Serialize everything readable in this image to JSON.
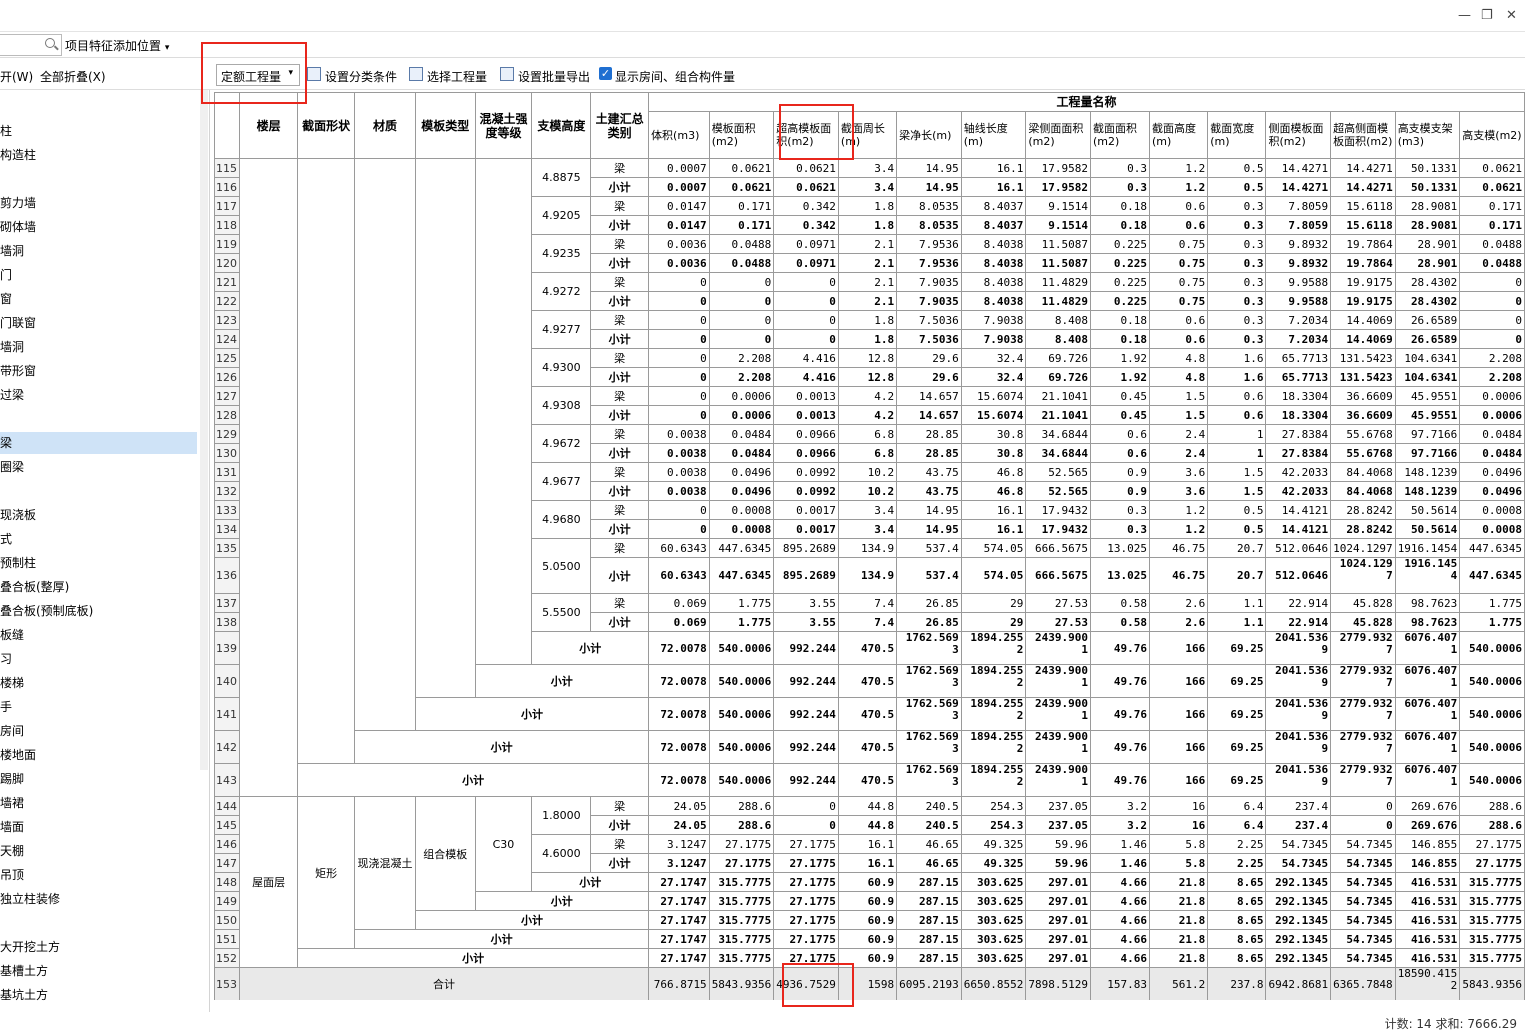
{
  "toolbar": {
    "feature_pos": "项目特征添加位置",
    "expand": "开(W)",
    "collapse_all": "全部折叠(X)",
    "quota_combo": "定额工程量",
    "set_category": "设置分类条件",
    "select_qty": "选择工程量",
    "batch_export": "设置批量导出",
    "show_rooms": "显示房间、组合构件量"
  },
  "sidebar": [
    "柱",
    "构造柱",
    "",
    "剪力墙",
    "砌体墙",
    "墙洞",
    "门",
    "窗",
    "门联窗",
    "墙洞",
    "带形窗",
    "过梁",
    "",
    "梁",
    "圈梁",
    "",
    "现浇板",
    "式",
    "预制柱",
    "叠合板(整厚)",
    "叠合板(预制底板)",
    "板缝",
    "习",
    "楼梯",
    "手",
    "房间",
    "楼地面",
    "踢脚",
    "墙裙",
    "墙面",
    "天棚",
    "吊顶",
    "独立柱装修",
    "",
    "大开挖土方",
    "基槽土方",
    "基坑土方"
  ],
  "header": {
    "floor": "楼层",
    "section": "截面形状",
    "material": "材质",
    "formwork": "模板类型",
    "concrete": "混凝土强度等级",
    "height": "支模高度",
    "category": "土建汇总类别",
    "qty_group": "工程量名称",
    "cols": [
      "体积(m3)",
      "模板面积(m2)",
      "超高模板面积(m2)",
      "截面周长(m)",
      "梁净长(m)",
      "轴线长度(m)",
      "梁侧面面积(m2)",
      "截面面积(m2)",
      "截面高度(m)",
      "截面宽度(m)",
      "侧面模板面积(m2)",
      "超高侧面模板面积(m2)",
      "高支模支架(m3)",
      "高支模(m2)"
    ]
  },
  "labels": {
    "beam": "梁",
    "subtotal": "小计",
    "total": "合计"
  },
  "heights": [
    {
      "h": "4.8875",
      "beam": [
        "0.0007",
        "0.0621",
        "0.0621",
        "3.4",
        "14.95",
        "16.1",
        "17.9582",
        "0.3",
        "1.2",
        "0.5",
        "14.4271",
        "14.4271",
        "50.1331",
        "0.0621"
      ],
      "sub": [
        "0.0007",
        "0.0621",
        "0.0621",
        "3.4",
        "14.95",
        "16.1",
        "17.9582",
        "0.3",
        "1.2",
        "0.5",
        "14.4271",
        "14.4271",
        "50.1331",
        "0.0621"
      ]
    },
    {
      "h": "4.9205",
      "beam": [
        "0.0147",
        "0.171",
        "0.342",
        "1.8",
        "8.0535",
        "8.4037",
        "9.1514",
        "0.18",
        "0.6",
        "0.3",
        "7.8059",
        "15.6118",
        "28.9081",
        "0.171"
      ],
      "sub": [
        "0.0147",
        "0.171",
        "0.342",
        "1.8",
        "8.0535",
        "8.4037",
        "9.1514",
        "0.18",
        "0.6",
        "0.3",
        "7.8059",
        "15.6118",
        "28.9081",
        "0.171"
      ]
    },
    {
      "h": "4.9235",
      "beam": [
        "0.0036",
        "0.0488",
        "0.0971",
        "2.1",
        "7.9536",
        "8.4038",
        "11.5087",
        "0.225",
        "0.75",
        "0.3",
        "9.8932",
        "19.7864",
        "28.901",
        "0.0488"
      ],
      "sub": [
        "0.0036",
        "0.0488",
        "0.0971",
        "2.1",
        "7.9536",
        "8.4038",
        "11.5087",
        "0.225",
        "0.75",
        "0.3",
        "9.8932",
        "19.7864",
        "28.901",
        "0.0488"
      ]
    },
    {
      "h": "4.9272",
      "beam": [
        "0",
        "0",
        "0",
        "2.1",
        "7.9035",
        "8.4038",
        "11.4829",
        "0.225",
        "0.75",
        "0.3",
        "9.9588",
        "19.9175",
        "28.4302",
        "0"
      ],
      "sub": [
        "0",
        "0",
        "0",
        "2.1",
        "7.9035",
        "8.4038",
        "11.4829",
        "0.225",
        "0.75",
        "0.3",
        "9.9588",
        "19.9175",
        "28.4302",
        "0"
      ]
    },
    {
      "h": "4.9277",
      "beam": [
        "0",
        "0",
        "0",
        "1.8",
        "7.5036",
        "7.9038",
        "8.408",
        "0.18",
        "0.6",
        "0.3",
        "7.2034",
        "14.4069",
        "26.6589",
        "0"
      ],
      "sub": [
        "0",
        "0",
        "0",
        "1.8",
        "7.5036",
        "7.9038",
        "8.408",
        "0.18",
        "0.6",
        "0.3",
        "7.2034",
        "14.4069",
        "26.6589",
        "0"
      ]
    },
    {
      "h": "4.9300",
      "beam": [
        "0",
        "2.208",
        "4.416",
        "12.8",
        "29.6",
        "32.4",
        "69.726",
        "1.92",
        "4.8",
        "1.6",
        "65.7713",
        "131.5423",
        "104.6341",
        "2.208"
      ],
      "sub": [
        "0",
        "2.208",
        "4.416",
        "12.8",
        "29.6",
        "32.4",
        "69.726",
        "1.92",
        "4.8",
        "1.6",
        "65.7713",
        "131.5423",
        "104.6341",
        "2.208"
      ]
    },
    {
      "h": "4.9308",
      "beam": [
        "0",
        "0.0006",
        "0.0013",
        "4.2",
        "14.657",
        "15.6074",
        "21.1041",
        "0.45",
        "1.5",
        "0.6",
        "18.3304",
        "36.6609",
        "45.9551",
        "0.0006"
      ],
      "sub": [
        "0",
        "0.0006",
        "0.0013",
        "4.2",
        "14.657",
        "15.6074",
        "21.1041",
        "0.45",
        "1.5",
        "0.6",
        "18.3304",
        "36.6609",
        "45.9551",
        "0.0006"
      ]
    },
    {
      "h": "4.9672",
      "beam": [
        "0.0038",
        "0.0484",
        "0.0966",
        "6.8",
        "28.85",
        "30.8",
        "34.6844",
        "0.6",
        "2.4",
        "1",
        "27.8384",
        "55.6768",
        "97.7166",
        "0.0484"
      ],
      "sub": [
        "0.0038",
        "0.0484",
        "0.0966",
        "6.8",
        "28.85",
        "30.8",
        "34.6844",
        "0.6",
        "2.4",
        "1",
        "27.8384",
        "55.6768",
        "97.7166",
        "0.0484"
      ]
    },
    {
      "h": "4.9677",
      "beam": [
        "0.0038",
        "0.0496",
        "0.0992",
        "10.2",
        "43.75",
        "46.8",
        "52.565",
        "0.9",
        "3.6",
        "1.5",
        "42.2033",
        "84.4068",
        "148.1239",
        "0.0496"
      ],
      "sub": [
        "0.0038",
        "0.0496",
        "0.0992",
        "10.2",
        "43.75",
        "46.8",
        "52.565",
        "0.9",
        "3.6",
        "1.5",
        "42.2033",
        "84.4068",
        "148.1239",
        "0.0496"
      ]
    },
    {
      "h": "4.9680",
      "beam": [
        "0",
        "0.0008",
        "0.0017",
        "3.4",
        "14.95",
        "16.1",
        "17.9432",
        "0.3",
        "1.2",
        "0.5",
        "14.4121",
        "28.8242",
        "50.5614",
        "0.0008"
      ],
      "sub": [
        "0",
        "0.0008",
        "0.0017",
        "3.4",
        "14.95",
        "16.1",
        "17.9432",
        "0.3",
        "1.2",
        "0.5",
        "14.4121",
        "28.8242",
        "50.5614",
        "0.0008"
      ]
    },
    {
      "h": "5.0500",
      "beam": [
        "60.6343",
        "447.6345",
        "895.2689",
        "134.9",
        "537.4",
        "574.05",
        "666.5675",
        "13.025",
        "46.75",
        "20.7",
        "512.0646",
        "1024.1297",
        "1916.1454",
        "447.6345"
      ],
      "sub": [
        "60.6343",
        "447.6345",
        "895.2689",
        "134.9",
        "537.4",
        "574.05",
        "666.5675",
        "13.025",
        "46.75",
        "20.7",
        "512.0646",
        "1024.129 7",
        "1916.145 4",
        "447.6345"
      ]
    },
    {
      "h": "5.5500",
      "beam": [
        "0.069",
        "1.775",
        "3.55",
        "7.4",
        "26.85",
        "29",
        "27.53",
        "0.58",
        "2.6",
        "1.1",
        "22.914",
        "45.828",
        "98.7623",
        "1.775"
      ],
      "sub": [
        "0.069",
        "1.775",
        "3.55",
        "7.4",
        "26.85",
        "29",
        "27.53",
        "0.58",
        "2.6",
        "1.1",
        "22.914",
        "45.828",
        "98.7623",
        "1.775"
      ]
    }
  ],
  "upper_subtotal": [
    "72.0078",
    "540.0006",
    "992.244",
    "470.5",
    "1762.569 3",
    "1894.255 2",
    "2439.900 1",
    "49.76",
    "166",
    "69.25",
    "2041.536 9",
    "2779.932 7",
    "6076.407 1",
    "540.0006"
  ],
  "roof": {
    "floor": "屋面层",
    "section": "矩形",
    "material": "现浇混凝土",
    "formwork": "组合模板",
    "concrete": "C30",
    "h1": {
      "h": "1.8000",
      "beam": [
        "24.05",
        "288.6",
        "0",
        "44.8",
        "240.5",
        "254.3",
        "237.05",
        "3.2",
        "16",
        "6.4",
        "237.4",
        "0",
        "269.676",
        "288.6"
      ],
      "sub": [
        "24.05",
        "288.6",
        "0",
        "44.8",
        "240.5",
        "254.3",
        "237.05",
        "3.2",
        "16",
        "6.4",
        "237.4",
        "0",
        "269.676",
        "288.6"
      ]
    },
    "h2": {
      "h": "4.6000",
      "beam": [
        "3.1247",
        "27.1775",
        "27.1775",
        "16.1",
        "46.65",
        "49.325",
        "59.96",
        "1.46",
        "5.8",
        "2.25",
        "54.7345",
        "54.7345",
        "146.855",
        "27.1775"
      ],
      "sub": [
        "3.1247",
        "27.1775",
        "27.1775",
        "16.1",
        "46.65",
        "49.325",
        "59.96",
        "1.46",
        "5.8",
        "2.25",
        "54.7345",
        "54.7345",
        "146.855",
        "27.1775"
      ]
    },
    "sub": [
      "27.1747",
      "315.7775",
      "27.1775",
      "60.9",
      "287.15",
      "303.625",
      "297.01",
      "4.66",
      "21.8",
      "8.65",
      "292.1345",
      "54.7345",
      "416.531",
      "315.7775"
    ]
  },
  "total": [
    "766.8715",
    "5843.9356",
    "4936.7529",
    "1598",
    "6095.2193",
    "6650.8552",
    "7898.5129",
    "157.83",
    "561.2",
    "237.8",
    "6942.8681",
    "6365.7848",
    "18590.415 2",
    "5843.9356"
  ],
  "status": "计数: 14  求和: 7666.29"
}
